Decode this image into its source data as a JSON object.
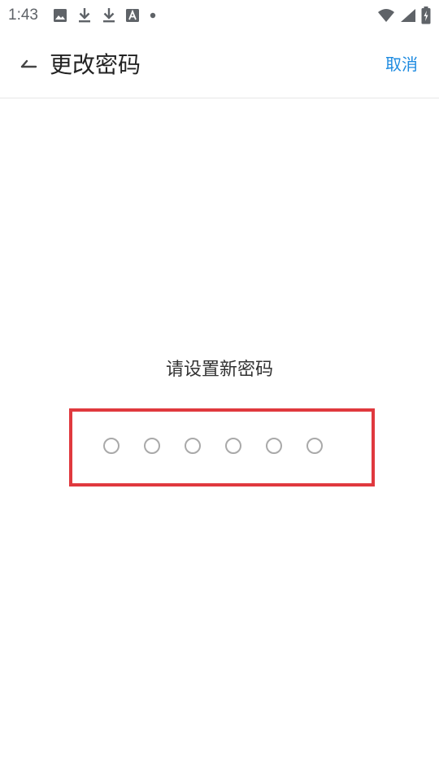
{
  "status_bar": {
    "time": "1:43",
    "icons": [
      "image-icon",
      "download-icon",
      "download-icon",
      "font-icon",
      "dot-icon",
      "wifi-icon",
      "signal-icon",
      "battery-charging-icon"
    ]
  },
  "app_bar": {
    "title": "更改密码",
    "cancel_label": "取消",
    "back_icon": "back-arrow-icon"
  },
  "pin_entry": {
    "prompt": "请设置新密码",
    "length": 6,
    "filled": 0
  },
  "colors": {
    "accent": "#1e8be0",
    "highlight_border": "#e0393e",
    "dot_border": "#a9a9a9",
    "title_text": "#222222"
  }
}
